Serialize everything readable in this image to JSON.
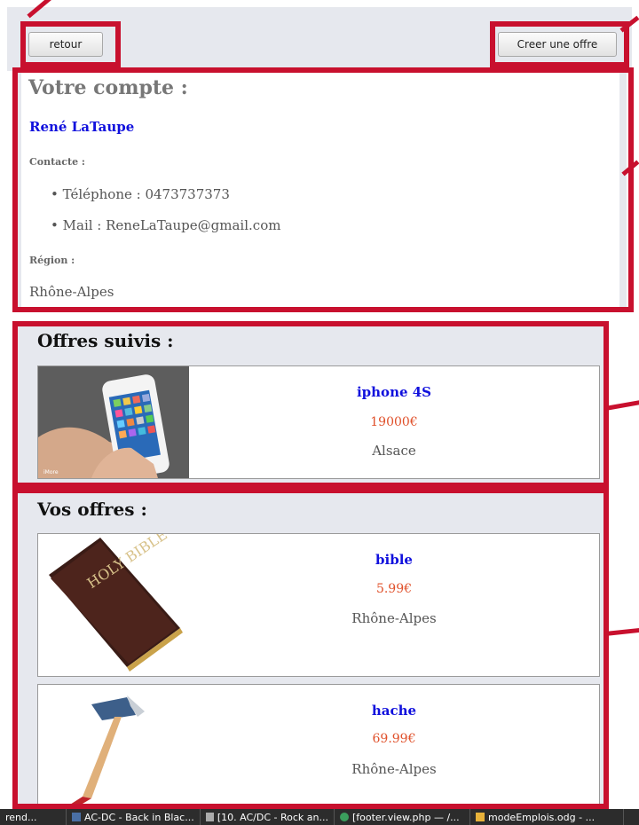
{
  "top": {
    "back_label": "retour",
    "create_label": "Creer une offre"
  },
  "account": {
    "title": "Votre compte :",
    "user_name": "René LaTaupe",
    "contact_heading": "Contacte :",
    "phone": "Téléphone : 0473737373",
    "mail": "Mail : ReneLaTaupe@gmail.com",
    "region_heading": "Région :",
    "region": "Rhône-Alpes"
  },
  "followed": {
    "title": "Offres suivis :",
    "items": [
      {
        "title": "iphone 4S",
        "price": "19000€",
        "region": "Alsace",
        "image": "iphone-photo",
        "watermark": "iMore"
      }
    ]
  },
  "mine": {
    "title": "Vos offres :",
    "items": [
      {
        "title": "bible",
        "price": "5.99€",
        "region": "Rhône-Alpes",
        "image": "holy-bible-photo",
        "cover_text": "HOLY BIBLE"
      },
      {
        "title": "hache",
        "price": "69.99€",
        "region": "Rhône-Alpes",
        "image": "axe-photo"
      }
    ]
  },
  "taskbar": {
    "items": [
      "rend...",
      "AC-DC - Back in Blac...",
      "[10. AC/DC - Rock an...",
      "[footer.view.php — /...",
      "modeEmplois.odg - ..."
    ]
  },
  "colors": {
    "annotation_red": "#c8102e",
    "link_blue": "#1010dd",
    "price_orange": "#e0502a",
    "panel_gray": "#e6e8ee"
  }
}
